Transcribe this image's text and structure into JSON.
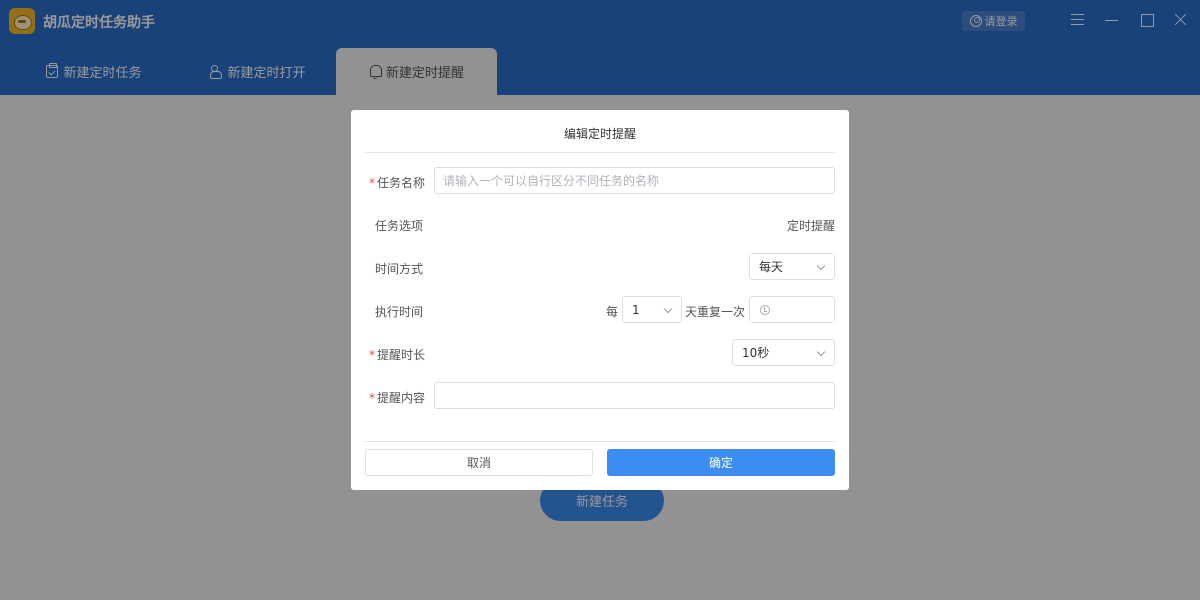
{
  "app": {
    "title": "胡瓜定时任务助手",
    "login_label": "请登录"
  },
  "tabs": [
    {
      "label": "新建定时任务",
      "icon": "clipboard-check-icon",
      "active": false
    },
    {
      "label": "新建定时打开",
      "icon": "hand-pointer-icon",
      "active": false
    },
    {
      "label": "新建定时提醒",
      "icon": "bell-icon",
      "active": true
    }
  ],
  "main": {
    "new_task_label": "新建任务"
  },
  "dialog": {
    "title": "编辑定时提醒",
    "required_mark": "*",
    "task_name": {
      "label": "任务名称",
      "placeholder": "请输入一个可以自行区分不同任务的名称",
      "value": ""
    },
    "task_option": {
      "label": "任务选项",
      "value": "定时提醒"
    },
    "time_mode": {
      "label": "时间方式",
      "value": "每天"
    },
    "exec_time": {
      "label": "执行时间",
      "prefix": "每",
      "interval_value": "1",
      "suffix": "天重复一次",
      "time_value": ""
    },
    "remind_duration": {
      "label": "提醒时长",
      "value": "10秒"
    },
    "remind_content": {
      "label": "提醒内容",
      "value": ""
    },
    "cancel_label": "取消",
    "ok_label": "确定"
  },
  "colors": {
    "header_blue": "#2b6fcb",
    "primary_button": "#3d8cf0",
    "required_red": "#e84b4b"
  }
}
